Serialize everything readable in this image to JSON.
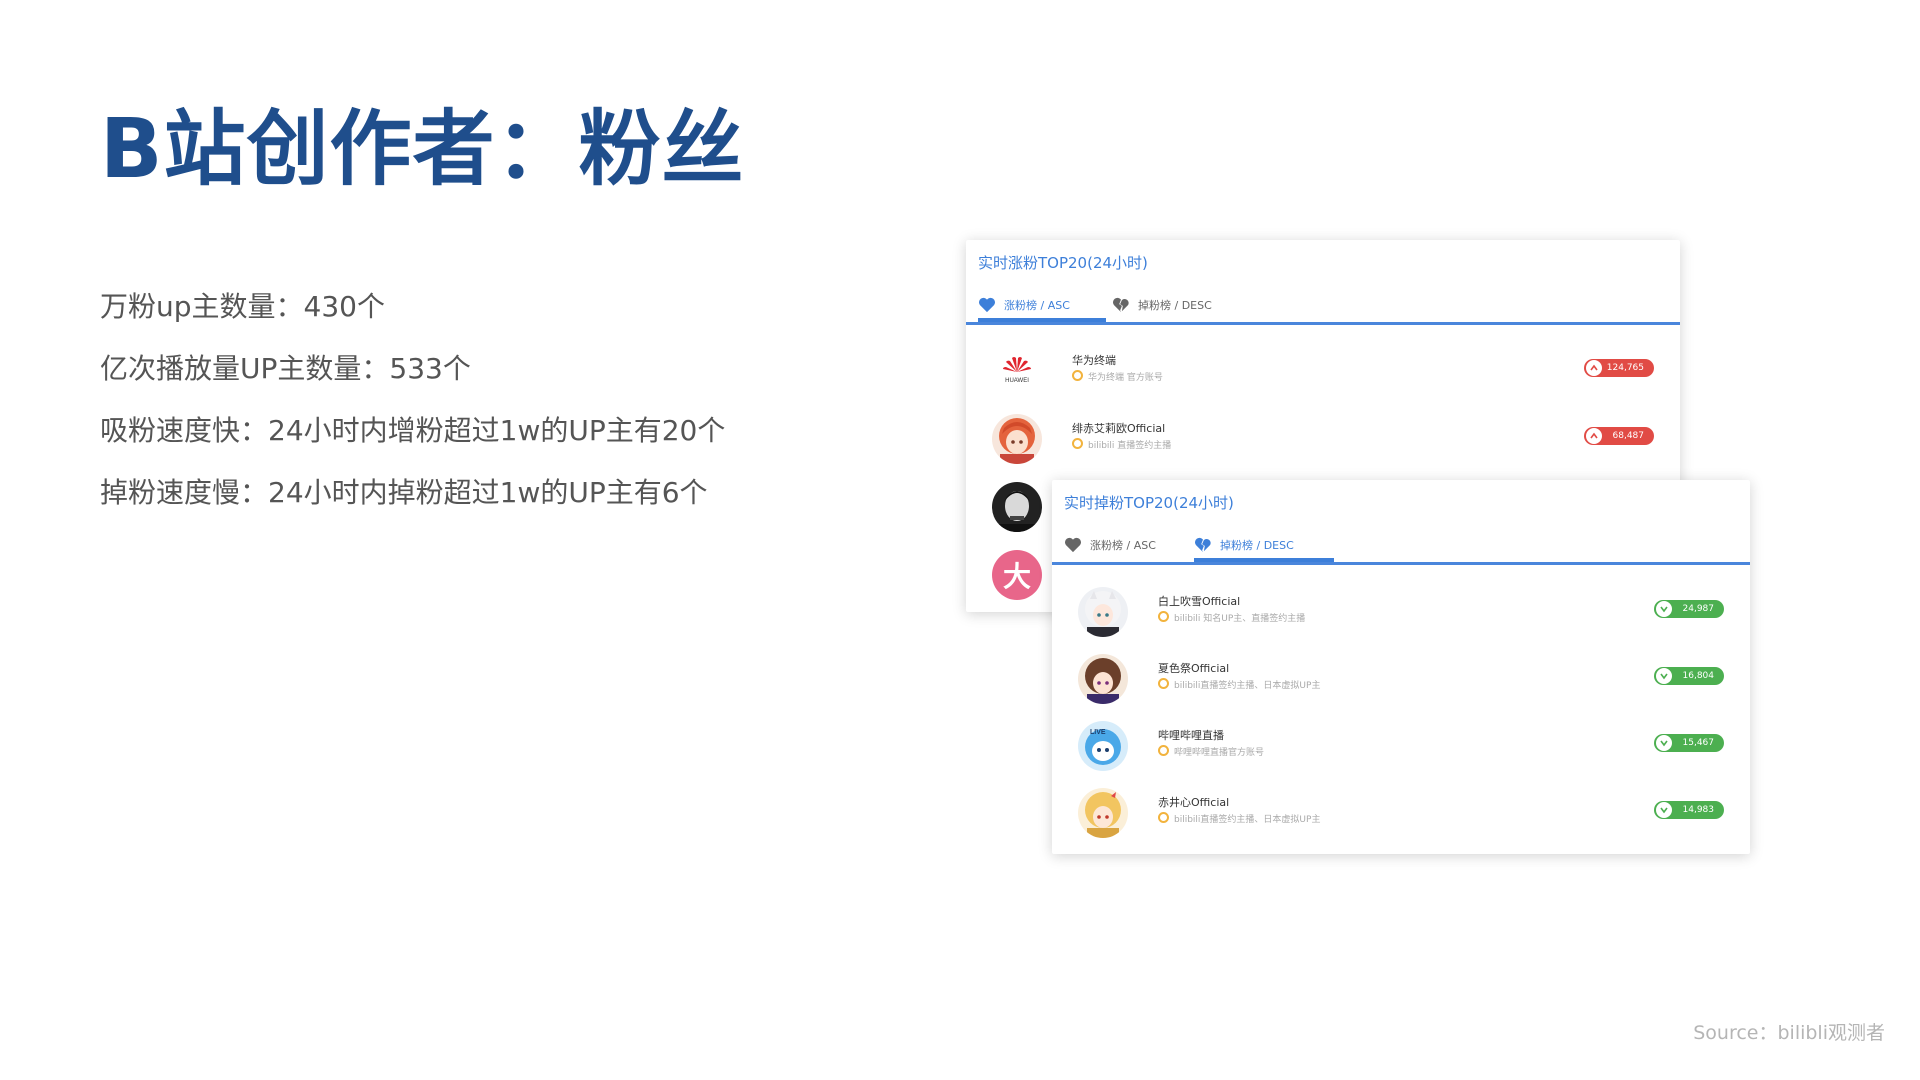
{
  "slide": {
    "title": "B站创作者：粉丝",
    "bullets": [
      "万粉up主数量：430个",
      "亿次播放量UP主数量：533个",
      "吸粉速度快：24小时内增粉超过1w的UP主有20个",
      "掉粉速度慢：24小时内掉粉超过1w的UP主有6个"
    ],
    "source": "Source：bilibli观测者"
  },
  "colors": {
    "title": "#1f4e8c",
    "accent": "#3d7fd9",
    "up_badge": "#e14b45",
    "down_badge": "#4caf50"
  },
  "gain_card": {
    "title": "实时涨粉TOP20(24小时)",
    "tab_asc": "涨粉榜 / ASC",
    "tab_desc": "掉粉榜 / DESC",
    "rows": [
      {
        "name": "华为终端",
        "desc": "华为终端 官方账号",
        "count": "124,765",
        "avatar_icon": "huawei-logo"
      },
      {
        "name": "绯赤艾莉欧Official",
        "desc": "bilibili 直播签约主播",
        "count": "68,487",
        "avatar_icon": "anime-girl-red-hair"
      },
      {
        "avatar_icon": "portrait-bw"
      },
      {
        "avatar_icon": "pink-circle",
        "avatar_text": "大"
      }
    ]
  },
  "loss_card": {
    "title": "实时掉粉TOP20(24小时)",
    "tab_asc": "涨粉榜 / ASC",
    "tab_desc": "掉粉榜 / DESC",
    "rows": [
      {
        "name": "白上吹雪Official",
        "desc": "bilibili 知名UP主、直播签约主播",
        "count": "24,987",
        "avatar_icon": "anime-girl-white-hair"
      },
      {
        "name": "夏色祭Official",
        "desc": "bilibili直播签约主播、日本虚拟UP主",
        "count": "16,804",
        "avatar_icon": "anime-girl-brown-hair"
      },
      {
        "name": "哔哩哔哩直播",
        "desc": "哔哩哔哩直播官方账号",
        "count": "15,467",
        "avatar_icon": "bilibili-live-mascot"
      },
      {
        "name": "赤井心Official",
        "desc": "bilibili直播签约主播、日本虚拟UP主",
        "count": "14,983",
        "avatar_icon": "anime-girl-blonde-hair"
      }
    ]
  }
}
